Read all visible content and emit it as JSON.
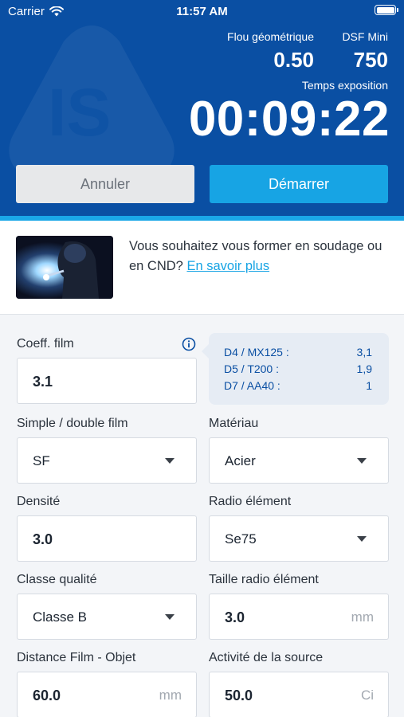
{
  "status_bar": {
    "carrier": "Carrier",
    "time": "11:57 AM"
  },
  "header": {
    "flou_label": "Flou géométrique",
    "flou_value": "0.50",
    "dsf_label": "DSF Mini",
    "dsf_value": "750",
    "temps_label": "Temps exposition",
    "timer": "00:09:22",
    "cancel_label": "Annuler",
    "start_label": "Démarrer"
  },
  "promo": {
    "text": "Vous souhaitez vous former en soudage ou en CND?",
    "link": "En savoir plus"
  },
  "form": {
    "coeff_film": {
      "label": "Coeff. film",
      "value": "3.1"
    },
    "coeff_table": [
      {
        "key": "D4 / MX125 :",
        "value": "3,1"
      },
      {
        "key": "D5 / T200 :",
        "value": "1,9"
      },
      {
        "key": "D7 / AA40 :",
        "value": "1"
      }
    ],
    "film_type": {
      "label": "Simple / double film",
      "value": "SF"
    },
    "materiau": {
      "label": "Matériau",
      "value": "Acier"
    },
    "densite": {
      "label": "Densité",
      "value": "3.0"
    },
    "radio_element": {
      "label": "Radio élément",
      "value": "Se75"
    },
    "classe": {
      "label": "Classe qualité",
      "value": "Classe B"
    },
    "taille": {
      "label": "Taille radio élément",
      "value": "3.0",
      "unit": "mm"
    },
    "distance": {
      "label": "Distance Film - Objet",
      "value": "60.0",
      "unit": "mm"
    },
    "activite": {
      "label": "Activité de la source",
      "value": "50.0",
      "unit": "Ci"
    }
  },
  "colors": {
    "primary": "#0a4fa3",
    "accent": "#17a4e4",
    "background": "#f3f5f8"
  },
  "icons": [
    "wifi-icon",
    "battery-icon",
    "info-icon",
    "chevron-down-icon",
    "logo-watermark"
  ]
}
